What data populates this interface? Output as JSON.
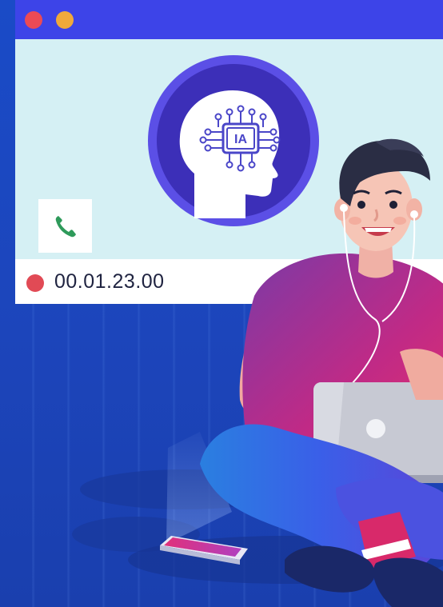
{
  "window": {
    "controls": [
      "close",
      "minimize"
    ],
    "colors": {
      "titlebar": "#3d44e8",
      "close": "#ec4a55",
      "minimize": "#f0a93b",
      "content": "#d5f0f4"
    }
  },
  "ai_badge": {
    "text": "IA",
    "icon": "ai-head-circuit-icon"
  },
  "call": {
    "icon": "phone-icon",
    "recording_indicator": "recording-dot-icon",
    "timer": "00.01.23.00"
  }
}
